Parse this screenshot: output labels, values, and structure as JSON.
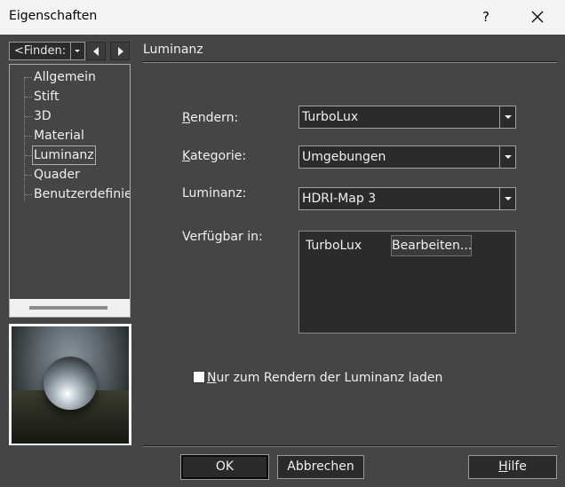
{
  "window": {
    "title": "Eigenschaften",
    "help_label": "?",
    "close_icon": "close-icon"
  },
  "sidebar": {
    "find_text": "<Finden:",
    "items": [
      {
        "label": "Allgemein",
        "selected": false
      },
      {
        "label": "Stift",
        "selected": false
      },
      {
        "label": "3D",
        "selected": false
      },
      {
        "label": "Material",
        "selected": false
      },
      {
        "label": "Luminanz",
        "selected": true
      },
      {
        "label": "Quader",
        "selected": false
      },
      {
        "label": "Benutzerdefiniert",
        "selected": false
      }
    ]
  },
  "panel": {
    "title": "Luminanz",
    "render_label_key": "R",
    "render_label_rest": "endern:",
    "render_value": "TurboLux",
    "category_label_key": "K",
    "category_label_rest": "ategorie:",
    "category_value": "Umgebungen",
    "luminance_label": "Luminanz:",
    "luminance_value": "HDRI-Map 3",
    "available_label": "Verfügbar in:",
    "available_items": [
      {
        "name": "TurboLux",
        "button": "Bearbeiten..."
      }
    ],
    "checkbox_key": "N",
    "checkbox_rest": "ur zum Rendern der Luminanz laden",
    "checkbox_checked": false
  },
  "buttons": {
    "ok": "OK",
    "cancel": "Abbrechen",
    "help_key": "H",
    "help_rest": "ilfe"
  }
}
